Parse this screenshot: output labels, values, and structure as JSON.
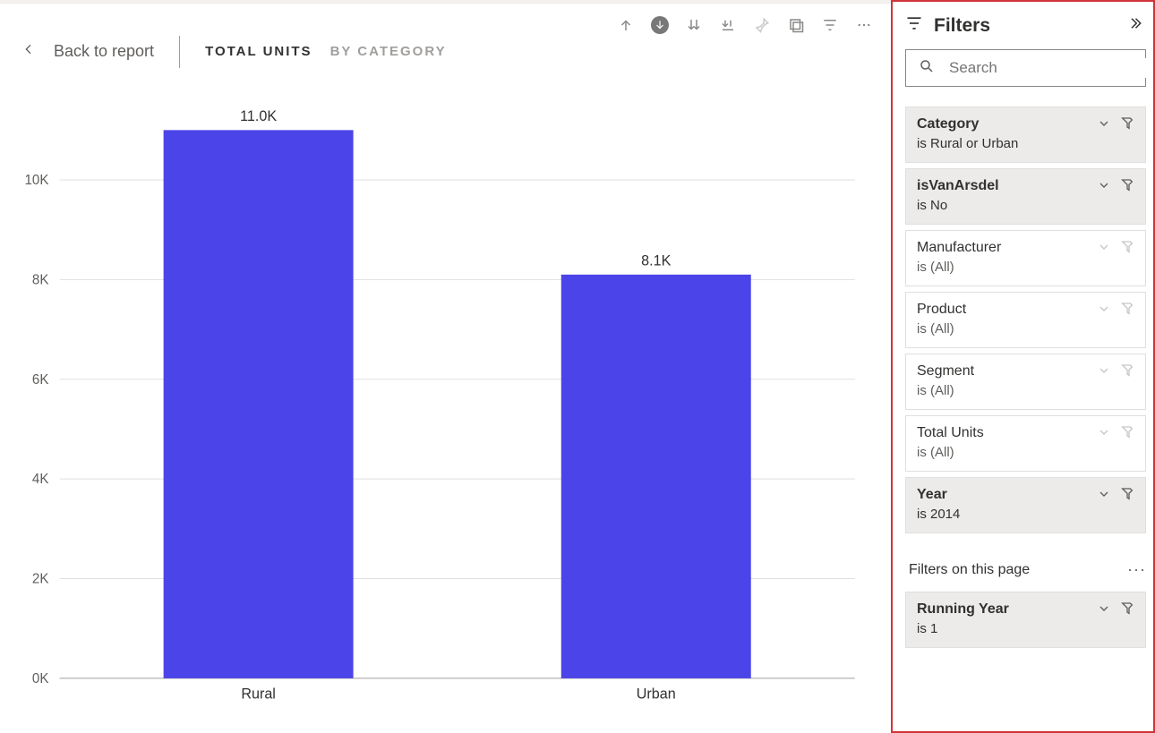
{
  "toolbar_icons": [
    "drill-up",
    "drill-down-on",
    "expand-down",
    "expand-all",
    "pin",
    "focus",
    "filter-icon",
    "more"
  ],
  "breadcrumb": {
    "back_label": "Back to report",
    "tabs": [
      {
        "label": "TOTAL UNITS",
        "active": true
      },
      {
        "label": "BY CATEGORY",
        "active": false
      }
    ]
  },
  "chart_data": {
    "type": "bar",
    "categories": [
      "Rural",
      "Urban"
    ],
    "values": [
      11000,
      8100
    ],
    "labels": [
      "11.0K",
      "8.1K"
    ],
    "title": "",
    "xlabel": "",
    "ylabel": "",
    "ylim": [
      0,
      11500
    ],
    "yticks": [
      0,
      2000,
      4000,
      6000,
      8000,
      10000
    ],
    "ytick_labels": [
      "0K",
      "2K",
      "4K",
      "6K",
      "8K",
      "10K"
    ]
  },
  "filters_pane": {
    "title": "Filters",
    "search_placeholder": "Search",
    "cards": [
      {
        "name": "Category",
        "value": "is Rural or Urban",
        "active": true
      },
      {
        "name": "isVanArsdel",
        "value": "is No",
        "active": true
      },
      {
        "name": "Manufacturer",
        "value": "is (All)",
        "active": false
      },
      {
        "name": "Product",
        "value": "is (All)",
        "active": false
      },
      {
        "name": "Segment",
        "value": "is (All)",
        "active": false
      },
      {
        "name": "Total Units",
        "value": "is (All)",
        "active": false
      },
      {
        "name": "Year",
        "value": "is 2014",
        "active": true
      }
    ],
    "page_section_label": "Filters on this page",
    "page_cards": [
      {
        "name": "Running Year",
        "value": "is 1",
        "active": true
      }
    ]
  },
  "colors": {
    "bar": "#4b44e8",
    "highlight_border": "#d13438"
  }
}
